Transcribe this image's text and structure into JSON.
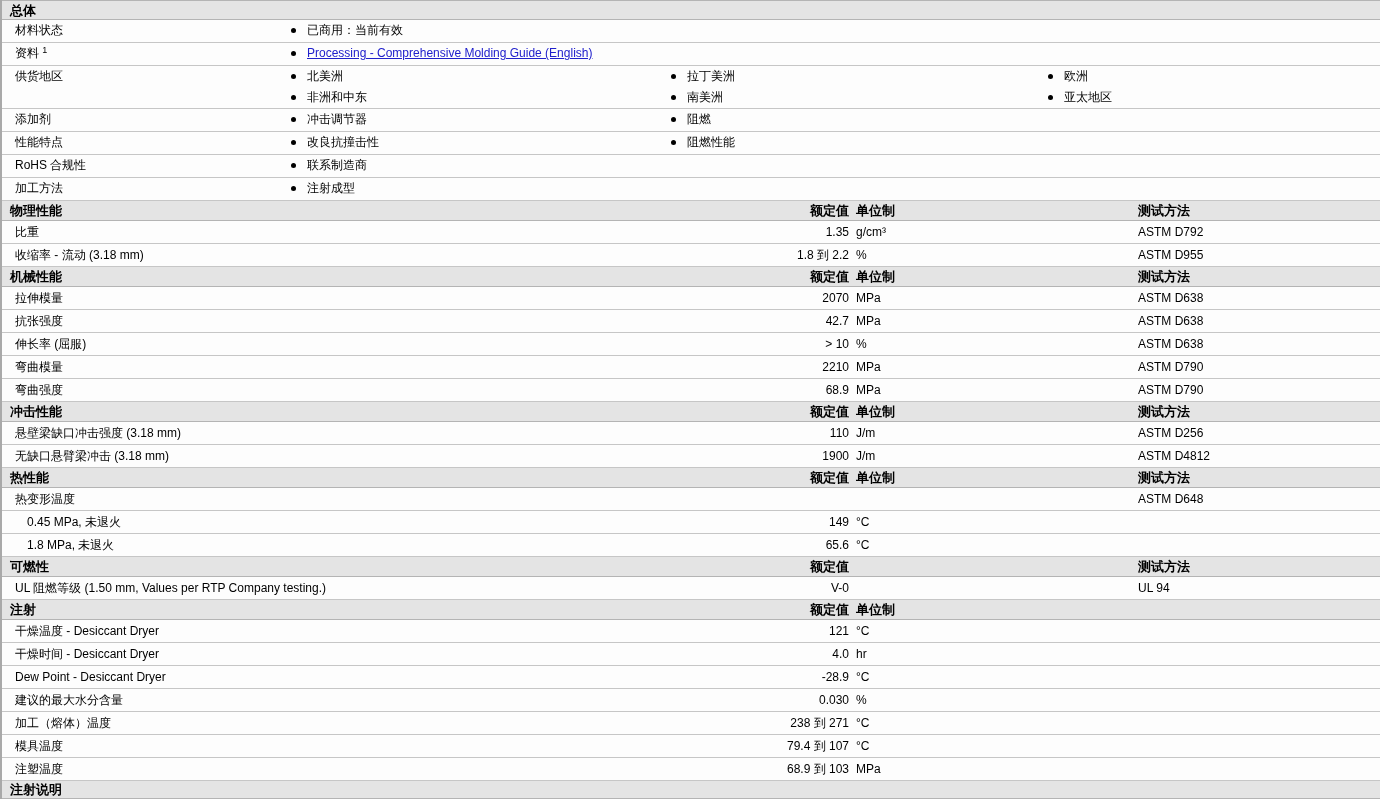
{
  "sections": [
    {
      "title": "总体",
      "kind": "general",
      "rows": [
        {
          "label": "材料状态",
          "kind": "text",
          "items": [
            "已商用：当前有效"
          ]
        },
        {
          "label": "资料 $^{1}$",
          "kind": "link",
          "items": [
            "Processing - Comprehensive Molding Guide (English)"
          ]
        },
        {
          "label": "供货地区",
          "kind": "text",
          "items": [
            "北美洲",
            "拉丁美洲",
            "欧洲",
            "非洲和中东",
            "南美洲",
            "亚太地区"
          ]
        },
        {
          "label": "添加剂",
          "kind": "text",
          "items": [
            "冲击调节器",
            "阻燃"
          ]
        },
        {
          "label": "性能特点",
          "kind": "text",
          "items": [
            "改良抗撞击性",
            "阻燃性能"
          ]
        },
        {
          "label": "RoHS 合规性",
          "kind": "text",
          "items": [
            "联系制造商"
          ]
        },
        {
          "label": "加工方法",
          "kind": "text",
          "items": [
            "注射成型"
          ]
        }
      ]
    },
    {
      "title": "物理性能",
      "kind": "properties",
      "value_heading": "额定值",
      "unit_heading": "单位制",
      "method_heading": "测试方法",
      "rows": [
        {
          "label": "比重",
          "value": "1.35",
          "unit": "g/cm³",
          "method": "ASTM D792"
        },
        {
          "label": "收缩率 - 流动 (3.18 mm)",
          "value": "1.8 到 2.2",
          "unit": "%",
          "method": "ASTM D955"
        }
      ]
    },
    {
      "title": "机械性能",
      "kind": "properties",
      "value_heading": "额定值",
      "unit_heading": "单位制",
      "method_heading": "测试方法",
      "rows": [
        {
          "label": "拉伸模量",
          "value": "2070",
          "unit": "MPa",
          "method": "ASTM D638"
        },
        {
          "label": "抗张强度",
          "value": "42.7",
          "unit": "MPa",
          "method": "ASTM D638"
        },
        {
          "label": "伸长率 (屈服)",
          "value": "> 10",
          "unit": "%",
          "method": "ASTM D638"
        },
        {
          "label": "弯曲模量",
          "value": "2210",
          "unit": "MPa",
          "method": "ASTM D790"
        },
        {
          "label": "弯曲强度",
          "value": "68.9",
          "unit": "MPa",
          "method": "ASTM D790"
        }
      ]
    },
    {
      "title": "冲击性能",
      "kind": "properties",
      "value_heading": "额定值",
      "unit_heading": "单位制",
      "method_heading": "测试方法",
      "rows": [
        {
          "label": "悬壁梁缺口冲击强度 (3.18 mm)",
          "value": "110",
          "unit": "J/m",
          "method": "ASTM D256"
        },
        {
          "label": "无缺口悬臂梁冲击 (3.18 mm)",
          "value": "1900",
          "unit": "J/m",
          "method": "ASTM D4812"
        }
      ]
    },
    {
      "title": "热性能",
      "kind": "properties",
      "value_heading": "额定值",
      "unit_heading": "单位制",
      "method_heading": "测试方法",
      "rows": [
        {
          "label": "热变形温度",
          "method": "ASTM D648",
          "children": [
            {
              "label": "0.45 MPa, 未退火",
              "value": "149",
              "unit": "°C"
            },
            {
              "label": "1.8 MPa, 未退火",
              "value": "65.6",
              "unit": "°C"
            }
          ]
        }
      ]
    },
    {
      "title": "可燃性",
      "kind": "properties",
      "value_heading": "额定值",
      "method_heading": "测试方法",
      "rows": [
        {
          "label": "UL 阻燃等级 (1.50 mm, Values per RTP Company testing.)",
          "value": "V-0",
          "method": "UL 94"
        }
      ]
    },
    {
      "title": "注射",
      "kind": "properties",
      "value_heading": "额定值",
      "unit_heading": "单位制",
      "rows": [
        {
          "label": "干燥温度 - Desiccant Dryer",
          "value": "121",
          "unit": "°C"
        },
        {
          "label": "干燥时间 - Desiccant Dryer",
          "value": "4.0",
          "unit": "hr"
        },
        {
          "label": "Dew Point - Desiccant Dryer",
          "value": "-28.9",
          "unit": "°C"
        },
        {
          "label": "建议的最大水分含量",
          "value": "0.030",
          "unit": "%"
        },
        {
          "label": "加工（熔体）温度",
          "value": "238 到 271",
          "unit": "°C"
        },
        {
          "label": "模具温度",
          "value": "79.4 到 107",
          "unit": "°C"
        },
        {
          "label": "注塑温度",
          "value": "68.9 到 103",
          "unit": "MPa"
        }
      ]
    },
    {
      "title": "注射说明",
      "kind": "properties"
    }
  ]
}
